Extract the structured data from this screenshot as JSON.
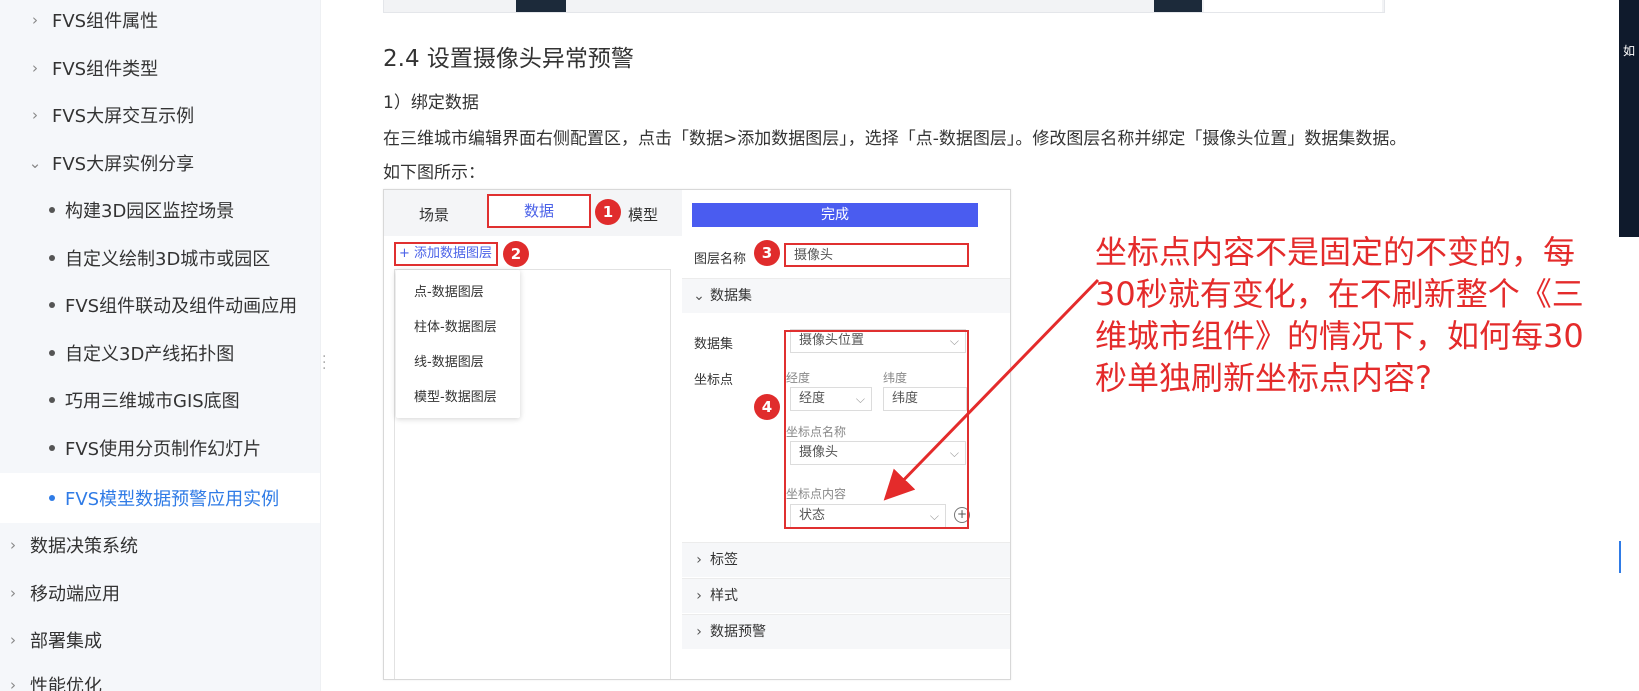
{
  "sidebar": {
    "items": [
      {
        "label": "FVS组件属性",
        "level": 1,
        "state": "collapsed"
      },
      {
        "label": "FVS组件类型",
        "level": 1,
        "state": "collapsed"
      },
      {
        "label": "FVS大屏交互示例",
        "level": 1,
        "state": "collapsed"
      },
      {
        "label": "FVS大屏实例分享",
        "level": 1,
        "state": "expanded"
      },
      {
        "label": "构建3D园区监控场景",
        "level": 2
      },
      {
        "label": "自定义绘制3D城市或园区",
        "level": 2
      },
      {
        "label": "FVS组件联动及组件动画应用",
        "level": 2
      },
      {
        "label": "自定义3D产线拓扑图",
        "level": 2
      },
      {
        "label": "巧用三维城市GIS底图",
        "level": 2
      },
      {
        "label": "FVS使用分页制作幻灯片",
        "level": 2
      },
      {
        "label": "FVS模型数据预警应用实例",
        "level": 2,
        "active": true
      },
      {
        "label": "数据决策系统",
        "level": 0,
        "state": "collapsed"
      },
      {
        "label": "移动端应用",
        "level": 0,
        "state": "collapsed"
      },
      {
        "label": "部署集成",
        "level": 0,
        "state": "collapsed"
      },
      {
        "label": "性能优化",
        "level": 0,
        "state": "collapsed"
      }
    ],
    "active_color": "#2f7be6"
  },
  "article": {
    "section_title": "2.4 设置摄像头异常预警",
    "step": "1）绑定数据",
    "instruction": "在三维城市编辑界面右侧配置区，点击「数据>添加数据图层」，选择「点-数据图层」。修改图层名称并绑定「摄像头位置」数据集数据。",
    "figure_caption": "如下图所示："
  },
  "figure": {
    "tabs": [
      "场景",
      "数据",
      "模型"
    ],
    "add_layer": "+ 添加数据图层",
    "layer_menu": [
      "点-数据图层",
      "柱体-数据图层",
      "线-数据图层",
      "模型-数据图层"
    ],
    "done_button": "完成",
    "layer_name_label": "图层名称",
    "layer_name_value": "摄像头",
    "dataset_section": "数据集",
    "dataset_label": "数据集",
    "dataset_value": "摄像头位置",
    "coord_label": "坐标点",
    "longitude_label": "经度",
    "latitude_label": "纬度",
    "longitude_value": "经度",
    "latitude_value": "纬度",
    "point_name_label": "坐标点名称",
    "point_name_value": "摄像头",
    "point_content_label": "坐标点内容",
    "point_content_value": "状态",
    "sections": [
      "标签",
      "样式",
      "数据预警"
    ],
    "markers": [
      "1",
      "2",
      "3",
      "4"
    ],
    "highlight_color": "#e03030",
    "accent_color": "#4a5cf0"
  },
  "annotation": {
    "text": "坐标点内容不是固定的不变的，每30秒就有变化，在不刷新整个《三维城市组件》的情况下，如何每30秒单独刷新坐标点内容?",
    "color": "#e42b2b"
  }
}
